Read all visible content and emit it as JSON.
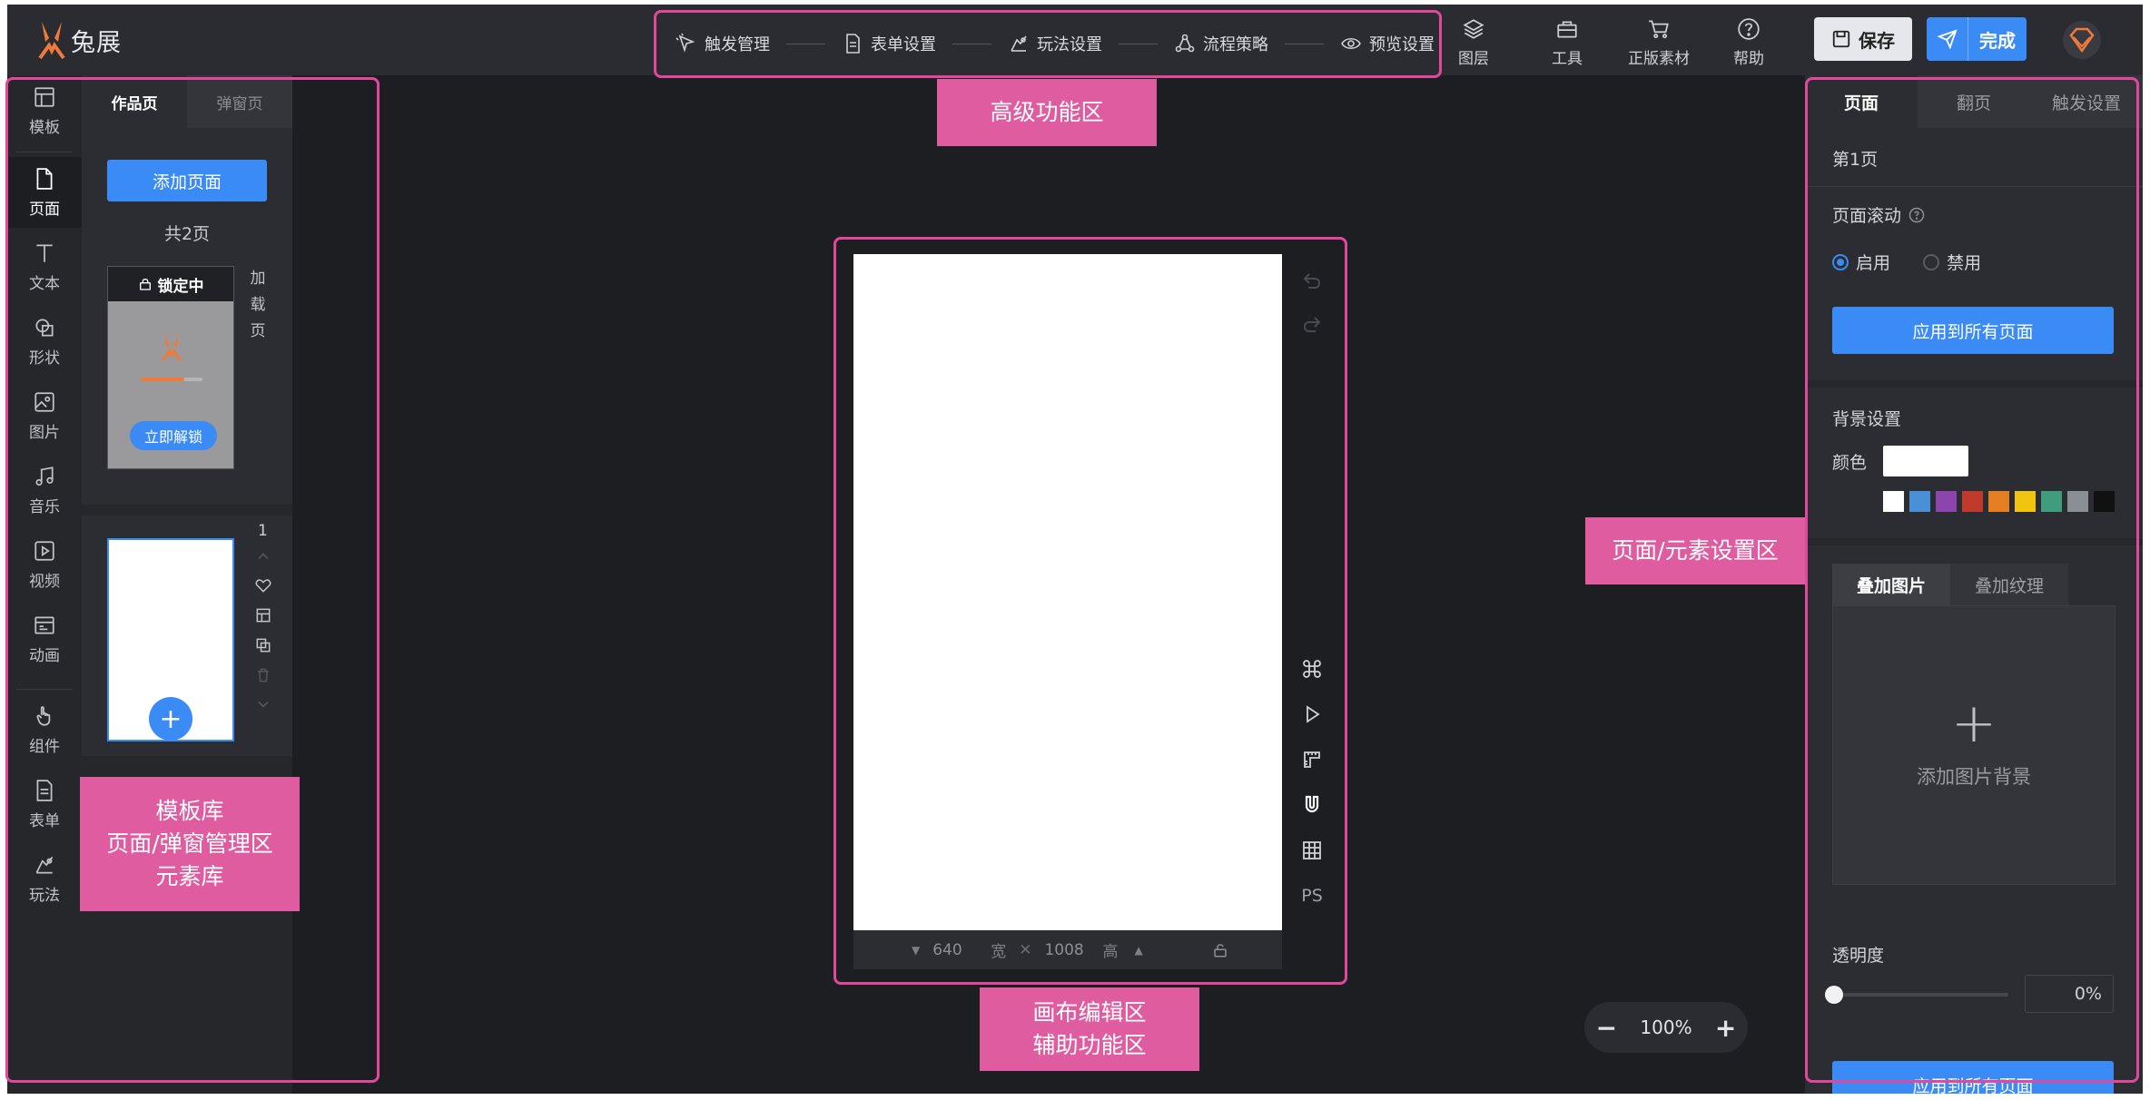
{
  "app": {
    "logo_text": "兔展",
    "brand_color": "#f07a3a",
    "accent_color": "#3a8bf5",
    "annotation_color": "#e05ca0"
  },
  "steps": [
    {
      "label": "触发管理",
      "icon": "trigger-icon"
    },
    {
      "label": "表单设置",
      "icon": "form-doc-icon"
    },
    {
      "label": "玩法设置",
      "icon": "puzzle-icon"
    },
    {
      "label": "流程策略",
      "icon": "flow-icon"
    },
    {
      "label": "预览设置",
      "icon": "eye-icon"
    }
  ],
  "tools": [
    {
      "label": "图层",
      "icon": "layers-icon"
    },
    {
      "label": "工具",
      "icon": "toolbox-icon"
    },
    {
      "label": "正版素材",
      "icon": "cart-icon"
    },
    {
      "label": "帮助",
      "icon": "help-icon"
    }
  ],
  "actions": {
    "save": "保存",
    "done": "完成"
  },
  "rail": [
    {
      "label": "模板",
      "icon": "template-icon"
    },
    {
      "label": "页面",
      "icon": "page-icon"
    },
    {
      "label": "文本",
      "icon": "text-icon"
    },
    {
      "label": "形状",
      "icon": "shape-icon"
    },
    {
      "label": "图片",
      "icon": "image-icon"
    },
    {
      "label": "音乐",
      "icon": "music-icon"
    },
    {
      "label": "视频",
      "icon": "video-icon"
    },
    {
      "label": "动画",
      "icon": "animation-icon"
    },
    {
      "label": "组件",
      "icon": "hand-icon"
    },
    {
      "label": "表单",
      "icon": "form-icon"
    },
    {
      "label": "玩法",
      "icon": "game-icon"
    }
  ],
  "page_panel": {
    "tabs": [
      "作品页",
      "弹窗页"
    ],
    "add_page": "添加页面",
    "count": "共2页",
    "lock_label": "锁定中",
    "unlock": "立即解锁",
    "loading_label": [
      "加",
      "载",
      "页"
    ],
    "page_number": "1"
  },
  "canvas": {
    "width": "640",
    "width_label": "宽",
    "height": "1008",
    "height_label": "高",
    "side_tools": [
      "command-icon",
      "play-icon",
      "ruler-icon",
      "magnet-icon",
      "grid-icon",
      "ps-icon"
    ],
    "ps_label": "PS",
    "zoom": "100%"
  },
  "right_panel": {
    "tabs": [
      "页面",
      "翻页",
      "触发设置"
    ],
    "page_title": "第1页",
    "scroll_label": "页面滚动",
    "scroll_options": [
      "启用",
      "禁用"
    ],
    "apply_all": "应用到所有页面",
    "bg_title": "背景设置",
    "color_label": "颜色",
    "current_color": "#ffffff",
    "swatches": [
      "#ffffff",
      "#4a90d9",
      "#8e44ad",
      "#c0392b",
      "#e67e22",
      "#f1c40f",
      "#3f9c7c",
      "#8a8f96",
      "#111111"
    ],
    "overlay_tabs": [
      "叠加图片",
      "叠加纹理"
    ],
    "add_bg_image": "添加图片背景",
    "opacity_label": "透明度",
    "opacity_value": "0%",
    "apply_all_bottom": "应用到所有页面"
  },
  "annotations": {
    "advanced": "高级功能区",
    "left": [
      "模板库",
      "页面/弹窗管理区",
      "元素库"
    ],
    "canvas": [
      "画布编辑区",
      "辅助功能区"
    ],
    "settings": "页面/元素设置区"
  }
}
